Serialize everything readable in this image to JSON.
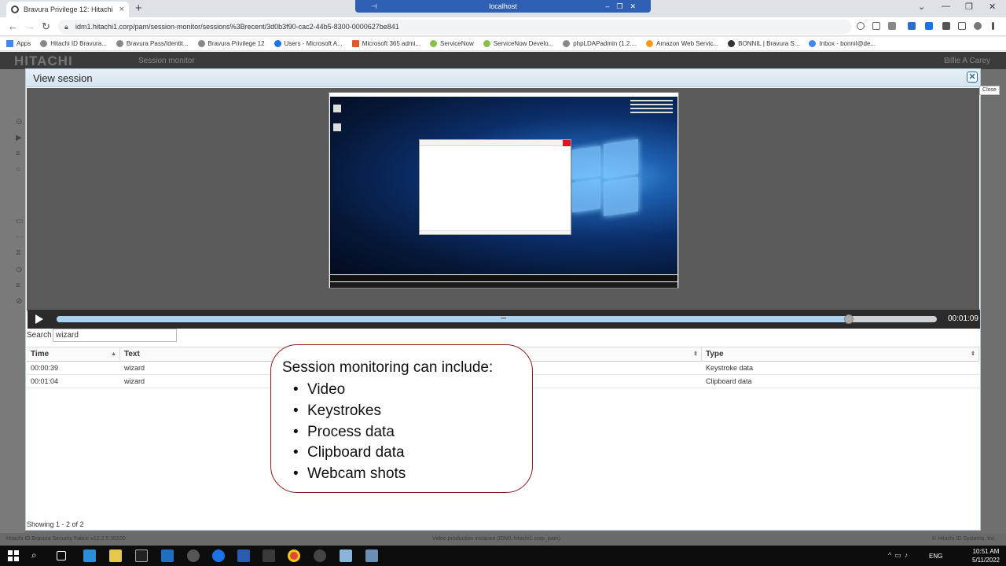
{
  "browser": {
    "tab_title": "Bravura Privilege 12: Hitachi ID B",
    "tab_close": "×",
    "new_tab": "+",
    "remote_title": "localhost",
    "url": "idm1.hitachi1.corp/pam/session-monitor/sessions%3Brecent/3d0b3f90-cac2-44b5-8300-0000627be841",
    "bookmarks": [
      "Apps",
      "Hitachi ID Bravura...",
      "Bravura Pass/Identit...",
      "Bravura Privilege 12",
      "Users - Microsoft A...",
      "Microsoft 365 admi...",
      "ServiceNow",
      "ServiceNow Develo...",
      "phpLDAPadmin (1.2....",
      "Amazon Web Servic...",
      "BONNIL | Bravura S...",
      "Inbox - bonnil@de..."
    ]
  },
  "app": {
    "logo": "HITACHI",
    "page": "Session monitor",
    "user": "Billie A Carey",
    "footer_left": "Hitachi ID Bravura Security Fabric v12.2.5.30100",
    "footer_center": "Video production instance (IDM1.hitachi1.corp_pam)",
    "footer_right": "© Hitachi ID Systems, Inc."
  },
  "modal": {
    "title": "View session",
    "close_tooltip": "Close",
    "player": {
      "progress": 0.9,
      "timecode": "00:01:09"
    },
    "search": {
      "label": "Search",
      "value": "wizard"
    },
    "table": {
      "columns": [
        "Time",
        "Text",
        "Type"
      ],
      "rows": [
        {
          "time": "00:00:39",
          "text": "wizard",
          "type": "Keystroke data"
        },
        {
          "time": "00:01:04",
          "text": "wizard",
          "type": "Clipboard data"
        }
      ]
    },
    "footer": "Showing 1 - 2 of 2"
  },
  "callout": {
    "title": "Session monitoring can include:",
    "items": [
      "Video",
      "Keystrokes",
      "Process data",
      "Clipboard data",
      "Webcam shots"
    ]
  },
  "taskbar": {
    "lang": "ENG",
    "time": "10:51 AM",
    "date": "5/11/2022"
  }
}
